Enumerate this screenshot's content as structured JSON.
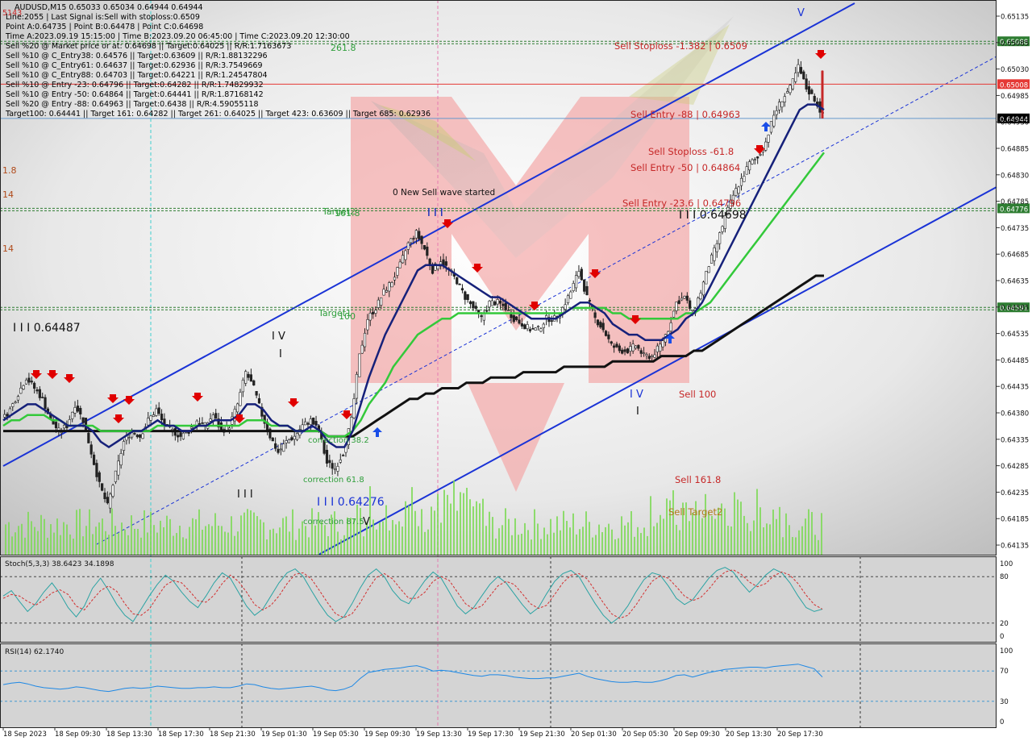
{
  "header": {
    "lines": [
      "AUDUSD,M15  0.65033 0.65034 0.64944 0.64944",
      "Line:2055 | Last Signal is:Sell with stoploss:0.6509",
      "Point A:0.64735 | Point B:0.64478 | Point C:0.64698",
      "Time A:2023.09.19 15:15:00 | Time B:2023.09.20 06:45:00 | Time C:2023.09.20 12:30:00",
      "Sell %20 @ Market price or at: 0.64698 || Target:0.64025 || R/R:1.7163673",
      "Sell %10 @ C_Entry38: 0.64576 || Target:0.63609 || R/R:1.88132296",
      "Sell %10 @ C_Entry61: 0.64637 || Target:0.62936 || R/R:3.7549669",
      "Sell %10 @ C_Entry88: 0.64703 || Target:0.64221 || R/R:1.24547804",
      "Sell %10 @ Entry -23: 0.64796 || Target:0.64282 || R/R:1.74829932",
      "Sell %10 @ Entry -50: 0.64864 || Target:0.64441 || R/R:1.87168142",
      "Sell %20 @ Entry -88: 0.64963 || Target:0.6438 || R/R:4.59055118",
      "Target100: 0.64441 || Target 161: 0.64282 || Target 261: 0.64025 || Target 423: 0.63609 || Target 685: 0.62936"
    ],
    "corner_label": "5143"
  },
  "chart_data": [
    {
      "type": "candlestick",
      "symbol": "AUDUSD",
      "timeframe": "M15",
      "ohlc_current": {
        "open": 0.65033,
        "high": 0.65034,
        "low": 0.64944,
        "close": 0.64944
      },
      "ylim": [
        0.64135,
        0.65135
      ],
      "yticks": [
        "0.65135",
        "0.65085",
        "0.65030",
        "0.64985",
        "0.64930",
        "0.64885",
        "0.64830",
        "0.64785",
        "0.64735",
        "0.64685",
        "0.64635",
        "0.64585",
        "0.64535",
        "0.64485",
        "0.64435",
        "0.64380",
        "0.64335",
        "0.64285",
        "0.64235",
        "0.64185",
        "0.64135"
      ],
      "xticks": [
        "18 Sep 2023",
        "18 Sep 09:30",
        "18 Sep 13:30",
        "18 Sep 17:30",
        "18 Sep 21:30",
        "19 Sep 01:30",
        "19 Sep 05:30",
        "19 Sep 09:30",
        "19 Sep 13:30",
        "19 Sep 17:30",
        "19 Sep 21:30",
        "20 Sep 01:30",
        "20 Sep 05:30",
        "20 Sep 09:30",
        "20 Sep 13:30",
        "20 Sep 17:30"
      ],
      "close_path": [
        0.6438,
        0.644,
        0.6443,
        0.6446,
        0.6444,
        0.6442,
        0.6438,
        0.6436,
        0.6437,
        0.6441,
        0.6438,
        0.6432,
        0.6426,
        0.6422,
        0.6428,
        0.6434,
        0.6436,
        0.6435,
        0.6438,
        0.644,
        0.6437,
        0.6436,
        0.6435,
        0.6436,
        0.6438,
        0.6437,
        0.6439,
        0.6436,
        0.6437,
        0.6441,
        0.6447,
        0.6444,
        0.6439,
        0.6435,
        0.6432,
        0.6434,
        0.6435,
        0.6437,
        0.6438,
        0.6436,
        0.643,
        0.6429,
        0.6432,
        0.6438,
        0.645,
        0.6457,
        0.6459,
        0.6462,
        0.6464,
        0.6467,
        0.6471,
        0.6473,
        0.647,
        0.6466,
        0.6468,
        0.6466,
        0.6464,
        0.6461,
        0.6459,
        0.6457,
        0.646,
        0.646,
        0.6459,
        0.6457,
        0.6456,
        0.6455,
        0.6455,
        0.6457,
        0.6457,
        0.6459,
        0.6462,
        0.6466,
        0.6461,
        0.6457,
        0.6455,
        0.6452,
        0.6451,
        0.6451,
        0.6452,
        0.645,
        0.645,
        0.6452,
        0.6455,
        0.646,
        0.6461,
        0.6458,
        0.6462,
        0.6467,
        0.6471,
        0.6476,
        0.648,
        0.6483,
        0.6486,
        0.6487,
        0.649,
        0.6495,
        0.6498,
        0.65,
        0.6504,
        0.65,
        0.6498,
        0.6495
      ],
      "ma_fast": [
        0.6438,
        0.6439,
        0.644,
        0.6441,
        0.6441,
        0.644,
        0.6439,
        0.6438,
        0.6437,
        0.6437,
        0.6437,
        0.6436,
        0.6434,
        0.6433,
        0.6434,
        0.6435,
        0.6436,
        0.6436,
        0.6437,
        0.6438,
        0.6437,
        0.6437,
        0.6436,
        0.6436,
        0.6437,
        0.6437,
        0.6438,
        0.6438,
        0.6438,
        0.6439,
        0.6441,
        0.6441,
        0.644,
        0.6438,
        0.6437,
        0.6437,
        0.6436,
        0.6436,
        0.6437,
        0.6436,
        0.6434,
        0.6433,
        0.6433,
        0.6436,
        0.6441,
        0.6446,
        0.645,
        0.6454,
        0.6457,
        0.646,
        0.6463,
        0.6466,
        0.6467,
        0.6467,
        0.6467,
        0.6466,
        0.6465,
        0.6464,
        0.6463,
        0.6462,
        0.6461,
        0.6461,
        0.646,
        0.6459,
        0.6458,
        0.6457,
        0.6457,
        0.6457,
        0.6457,
        0.6458,
        0.6459,
        0.646,
        0.646,
        0.6459,
        0.6458,
        0.6456,
        0.6455,
        0.6454,
        0.6454,
        0.6453,
        0.6453,
        0.6453,
        0.6454,
        0.6455,
        0.6457,
        0.6458,
        0.646,
        0.6463,
        0.6466,
        0.6469,
        0.6472,
        0.6475,
        0.6478,
        0.6481,
        0.6484,
        0.6487,
        0.649,
        0.6493,
        0.6496,
        0.6497,
        0.6497,
        0.6496
      ],
      "ma_mid": [
        0.6437,
        0.6438,
        0.6438,
        0.6439,
        0.6439,
        0.6439,
        0.6438,
        0.6438,
        0.6437,
        0.6437,
        0.6437,
        0.6437,
        0.6436,
        0.6436,
        0.6436,
        0.6436,
        0.6436,
        0.6436,
        0.6436,
        0.6437,
        0.6437,
        0.6437,
        0.6437,
        0.6437,
        0.6437,
        0.6437,
        0.6437,
        0.6437,
        0.6437,
        0.6437,
        0.6438,
        0.6438,
        0.6438,
        0.6437,
        0.6437,
        0.6437,
        0.6436,
        0.6436,
        0.6436,
        0.6436,
        0.6435,
        0.6435,
        0.6435,
        0.6436,
        0.6438,
        0.6441,
        0.6443,
        0.6445,
        0.6448,
        0.645,
        0.6452,
        0.6454,
        0.6455,
        0.6456,
        0.6457,
        0.6457,
        0.6458,
        0.6458,
        0.6458,
        0.6458,
        0.6458,
        0.6458,
        0.6458,
        0.6458,
        0.6458,
        0.6458,
        0.6458,
        0.6458,
        0.6458,
        0.6458,
        0.6459,
        0.6459,
        0.6459,
        0.6459,
        0.6459,
        0.6458,
        0.6458,
        0.6457,
        0.6457,
        0.6457,
        0.6457,
        0.6457,
        0.6457,
        0.6457,
        0.6458,
        0.6458,
        0.6459,
        0.646,
        0.6462,
        0.6464,
        0.6466,
        0.6468,
        0.647,
        0.6472,
        0.6474,
        0.6476,
        0.6478,
        0.648,
        0.6482,
        0.6484,
        0.6486,
        0.6488
      ],
      "ma_slow": [
        0.6436,
        0.6436,
        0.6436,
        0.6436,
        0.6436,
        0.6436,
        0.6436,
        0.6436,
        0.6436,
        0.6436,
        0.6436,
        0.6436,
        0.6436,
        0.6436,
        0.6436,
        0.6436,
        0.6436,
        0.6436,
        0.6436,
        0.6436,
        0.6436,
        0.6436,
        0.6436,
        0.6436,
        0.6436,
        0.6436,
        0.6436,
        0.6436,
        0.6436,
        0.6436,
        0.6436,
        0.6436,
        0.6436,
        0.6436,
        0.6436,
        0.6436,
        0.6436,
        0.6436,
        0.6436,
        0.6436,
        0.6435,
        0.6435,
        0.6435,
        0.6435,
        0.6436,
        0.6437,
        0.6438,
        0.6439,
        0.644,
        0.6441,
        0.6442,
        0.6442,
        0.6443,
        0.6443,
        0.6444,
        0.6444,
        0.6444,
        0.6445,
        0.6445,
        0.6445,
        0.6446,
        0.6446,
        0.6446,
        0.6446,
        0.6447,
        0.6447,
        0.6447,
        0.6447,
        0.6447,
        0.6448,
        0.6448,
        0.6448,
        0.6448,
        0.6448,
        0.6448,
        0.6449,
        0.6449,
        0.6449,
        0.6449,
        0.6449,
        0.6449,
        0.645,
        0.645,
        0.645,
        0.645,
        0.6451,
        0.6451,
        0.6452,
        0.6453,
        0.6454,
        0.6455,
        0.6456,
        0.6457,
        0.6458,
        0.6459,
        0.646,
        0.6461,
        0.6462,
        0.6463,
        0.6464,
        0.6465,
        0.6465
      ],
      "horizontal_lines": [
        {
          "price": 0.65088,
          "label": "0.65088",
          "color": "#2e7d32",
          "style": "dotted"
        },
        {
          "price": 0.65008,
          "label": "0.65008",
          "color": "#e53935",
          "style": "solid"
        },
        {
          "price": 0.64944,
          "label": "0.64944",
          "color": "#6699cc",
          "style": "solid"
        },
        {
          "price": 0.64776,
          "label": "0.64776",
          "color": "#2e7d32",
          "style": "dotted"
        },
        {
          "price": 0.64591,
          "label": "0.64591",
          "color": "#2e7d32",
          "style": "dotted"
        }
      ],
      "annotations": {
        "green": [
          "261.8",
          "Target2",
          "161.8",
          "Target1",
          "100",
          "correction 38.2",
          "correction 61.8",
          "correction 87.5"
        ],
        "red": [
          "Sell Stoploss -1.382 | 0.6509",
          "Sell Entry -88 | 0.64963",
          "Sell Stoploss -61.8",
          "Sell Entry -50 | 0.64864",
          "Sell Entry -23.6 | 0.64796",
          "Sell 100",
          "Sell 161.8",
          "Sell Target2"
        ],
        "black": [
          "0 New Sell wave started",
          "I I I 0.64698",
          "I I I 0.64487",
          "I V",
          "I",
          "I I I",
          "I I I",
          "V",
          "I V",
          "I"
        ],
        "blue": [
          "I I I 0.64276",
          "I I I",
          "V"
        ],
        "left_edge": [
          "1.8",
          "14",
          "14"
        ]
      }
    },
    {
      "type": "line",
      "title": "Stoch(5,3,3) 38.6423 34.1898",
      "ylim": [
        0,
        100
      ],
      "yticks": [
        "100",
        "80",
        "20",
        "0"
      ],
      "series": [
        {
          "name": "Stoch %K",
          "color": "#2aa3a3",
          "values": [
            55,
            62,
            48,
            35,
            45,
            60,
            72,
            58,
            40,
            28,
            42,
            65,
            78,
            62,
            44,
            30,
            22,
            38,
            55,
            70,
            82,
            74,
            60,
            48,
            40,
            55,
            72,
            85,
            78,
            60,
            42,
            30,
            38,
            55,
            72,
            85,
            90,
            80,
            62,
            45,
            30,
            22,
            28,
            45,
            65,
            82,
            90,
            80,
            62,
            50,
            45,
            60,
            75,
            86,
            78,
            60,
            42,
            32,
            40,
            55,
            70,
            80,
            72,
            58,
            44,
            32,
            40,
            58,
            74,
            84,
            88,
            80,
            62,
            45,
            30,
            20,
            28,
            42,
            60,
            76,
            85,
            82,
            68,
            52,
            44,
            50,
            64,
            78,
            88,
            92,
            86,
            72,
            60,
            70,
            82,
            90,
            85,
            72,
            55,
            40,
            35,
            38
          ]
        },
        {
          "name": "Stoch %D",
          "color": "#d32f2f",
          "values": [
            52,
            57,
            55,
            48,
            43,
            50,
            59,
            63,
            57,
            42,
            37,
            50,
            62,
            68,
            61,
            45,
            32,
            30,
            38,
            54,
            69,
            75,
            72,
            61,
            49,
            47,
            56,
            71,
            82,
            74,
            60,
            44,
            37,
            43,
            55,
            71,
            83,
            85,
            77,
            62,
            46,
            32,
            27,
            32,
            46,
            64,
            79,
            84,
            77,
            64,
            52,
            52,
            60,
            74,
            80,
            75,
            60,
            45,
            38,
            42,
            55,
            68,
            74,
            70,
            58,
            45,
            39,
            43,
            57,
            72,
            82,
            84,
            77,
            62,
            46,
            32,
            26,
            30,
            43,
            59,
            74,
            81,
            78,
            67,
            55,
            49,
            53,
            64,
            77,
            86,
            89,
            83,
            73,
            67,
            71,
            81,
            86,
            82,
            71,
            56,
            44,
            38
          ]
        }
      ]
    },
    {
      "type": "line",
      "title": "RSI(14) 62.1740",
      "ylim": [
        0,
        100
      ],
      "yticks": [
        "100",
        "70",
        "30",
        "0"
      ],
      "series": [
        {
          "name": "RSI(14)",
          "color": "#1e88e5",
          "values": [
            52,
            54,
            55,
            53,
            50,
            48,
            47,
            46,
            47,
            49,
            48,
            46,
            44,
            43,
            45,
            47,
            48,
            47,
            48,
            50,
            49,
            48,
            47,
            47,
            48,
            48,
            49,
            48,
            48,
            50,
            53,
            52,
            49,
            47,
            46,
            47,
            48,
            49,
            50,
            48,
            45,
            44,
            46,
            50,
            60,
            68,
            70,
            72,
            73,
            74,
            76,
            77,
            74,
            70,
            71,
            70,
            68,
            66,
            64,
            63,
            65,
            65,
            64,
            62,
            61,
            60,
            60,
            61,
            61,
            63,
            65,
            67,
            63,
            60,
            58,
            56,
            55,
            55,
            56,
            55,
            55,
            57,
            60,
            64,
            65,
            62,
            65,
            68,
            70,
            72,
            73,
            74,
            75,
            75,
            74,
            76,
            77,
            78,
            79,
            76,
            73,
            62
          ]
        }
      ]
    }
  ]
}
